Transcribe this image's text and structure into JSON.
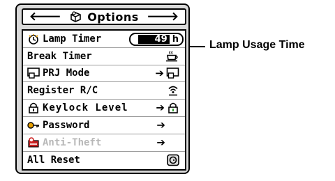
{
  "header": {
    "title": "Options",
    "left_arrow_icon": "arrow-left-icon",
    "right_arrow_icon": "arrow-right-icon",
    "title_icon": "options-puzzle-icon"
  },
  "menu_items": [
    {
      "label": "Lamp Timer",
      "icon": "lamp-timer-icon",
      "value": "49",
      "unit": "h"
    },
    {
      "label": "Break Timer",
      "right_icon": "coffee-cup-icon"
    },
    {
      "label": "PRJ Mode",
      "icon": "prj-mode-icon",
      "right_icon": "prj-mode-icon"
    },
    {
      "label": "Register R/C",
      "right_icon": "remote-signal-icon"
    },
    {
      "label": "Keylock Level",
      "icon": "padlock-icon",
      "right_icon": "padlock-icon"
    },
    {
      "label": "Password",
      "icon": "key-icon"
    },
    {
      "label": "Anti-Theft",
      "icon": "anti-theft-icon",
      "disabled": true
    },
    {
      "label": "All Reset",
      "right_icon": "reset-button-icon"
    }
  ],
  "callout": {
    "label": "Lamp Usage Time"
  },
  "colors": {
    "panel": "#d9d9d9",
    "anti_theft_icon": "#cc2222",
    "lamp_icon": "#e8a000",
    "disabled_text": "#b8b8b8"
  }
}
